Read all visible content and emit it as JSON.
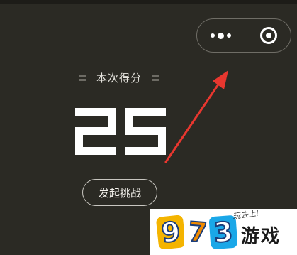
{
  "score": {
    "label": "本次得分",
    "value": "25"
  },
  "capsule": {
    "more_icon": "more-dots-icon",
    "close_icon": "target-close-icon"
  },
  "challenge_button": {
    "label": "发起挑战"
  },
  "watermark": {
    "digits": [
      "9",
      "7",
      "3"
    ],
    "slogan": "玩去上!",
    "game": "游戏"
  },
  "colors": {
    "background": "#2b2a24",
    "arrow": "#e8372f",
    "text": "#ffffff"
  }
}
